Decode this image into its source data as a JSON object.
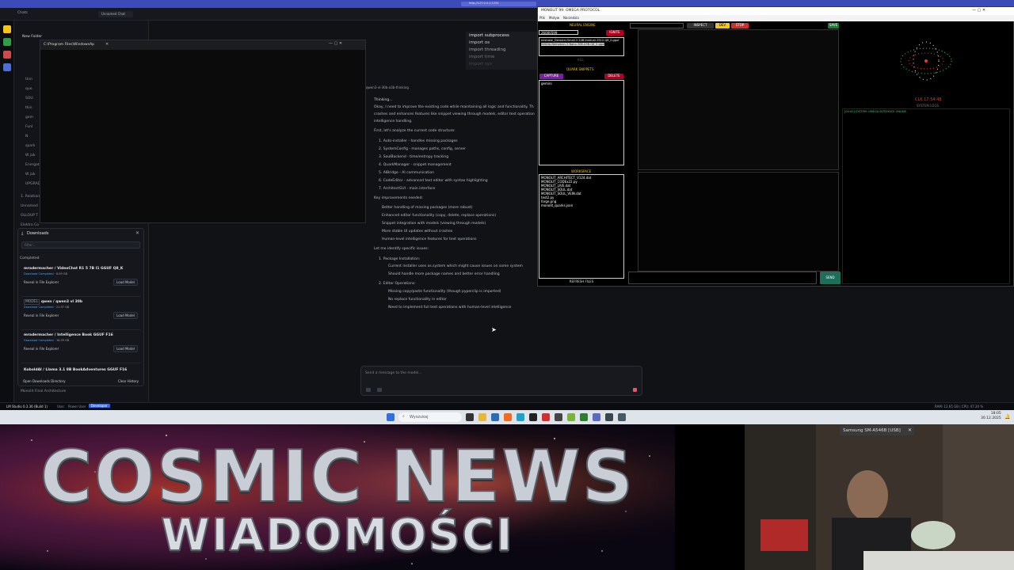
{
  "lm": {
    "title_tab": "LM Studio 0.3.36",
    "chat_tab": "Unnamed Chat",
    "sidebar": {
      "header": "Chats",
      "folder": "New Folder",
      "items": [
        "Unn",
        "quo",
        "SOU",
        "tkin",
        "gem",
        "Funl",
        "N",
        "spark",
        "W jak",
        "Energetic",
        "W jak",
        "UPGRAD",
        "1. Relation",
        "Unnamed",
        "OLLOUP T",
        "Elektro Co",
        "Energetic C"
      ],
      "footer": "Monolit Final Architecture"
    },
    "explorer_title": "C:\\Program Files\\WindowsAp",
    "status_bar": {
      "app": "LM Studio 0.3.36 (Build 1)",
      "modes": [
        "User",
        "Power User",
        "Developer"
      ],
      "right": "RAM: 12.65 GB | CPU: 47.20 %"
    }
  },
  "downloads": {
    "title": "Downloads",
    "filter_placeholder": "Filter...",
    "section": "Completed",
    "items": [
      {
        "name": "mradermacher / VideoChat R1 5 7B I1 GGUF Q8_K",
        "status": "Download Completed",
        "size": "8.09 GB",
        "reveal": "Reveal in File Explorer",
        "load": "Load Model"
      },
      {
        "name": "qwen / qwen3 vl 30b",
        "badge": "MODEL",
        "status": "Download Completed",
        "size": "21.97 GB",
        "reveal": "Reveal in File Explorer",
        "load": "Load Model"
      },
      {
        "name": "mradermacher / Intelligence Book GGUF F16",
        "status": "Download Completed",
        "size": "16.09 GB",
        "reveal": "Reveal in File Explorer",
        "load": "Load Model"
      },
      {
        "name": "KoboldAI / Llama 3.1 8B BookAdventures GGUF F16",
        "status": "",
        "size": "",
        "reveal": "",
        "load": ""
      }
    ],
    "open_dir": "Open Downloads Directory",
    "clear": "Clear History"
  },
  "imports": [
    "import subprocess",
    "import os",
    "import threading",
    "import time",
    "import sys"
  ],
  "chat": {
    "model_label": "qwen3-vl-30b-a3b-thinking",
    "thinking": "Thinking...",
    "intro": [
      "Okay, I need to improve the existing code while maintaining all logic and functionality. Th",
      "crashes and enhances features like snippet viewing through models, editor text operation",
      "intelligence handling."
    ],
    "analyze": "First, let's analyze the current code structure:",
    "structure": [
      "1. Auto-installer - handles missing packages",
      "2. SystemConfig - manages paths, config, server",
      "3. SoulBackend - time/entropy tracking",
      "4. QuarkManager - snippet management",
      "5. AIBridge - AI communication",
      "6. CodeEditor - advanced text editor with syntax highlighting",
      "7. ArchitectGUI - main interface"
    ],
    "improvements_title": "Key improvements needed:",
    "improvements": [
      "Better handling of missing packages (more robust)",
      "Enhanced editor functionality (copy, delete, replace operations)",
      "Snippet integration with models (viewing through models)",
      "More stable UI updates without crashes",
      "Human-level intelligence features for text operations"
    ],
    "issues_title": "Let me identify specific issues:",
    "issue1": "1. Package Installation:",
    "issue1_items": [
      "Current installer uses os.system which might cause issues on some system",
      "Should handle more package names and better error handling"
    ],
    "issue2": "2. Editor Operations:",
    "issue2_items": [
      "Missing copy/paste functionality (though pyperclip is imported)",
      "No replace functionality in editor",
      "Need to implement full text operations with human-level intelligence"
    ],
    "composer_placeholder": "Send a message to the model..."
  },
  "monolith": {
    "title": "MONOLIT 99: OMEGA PROTOCOL",
    "menu": [
      "Plik",
      "Motyw",
      "Narzedzia"
    ],
    "toolbar": {
      "inspect": "INSPECT",
      "dev": "DEV",
      "stop": "STOP",
      "save": "SAVE"
    },
    "neural_engine": "NEURAL ENGINE",
    "ignite": "IGNITE",
    "port": "26000599",
    "models": [
      "mistralai_Devstral-Small-2-24B-Instruct-2512-Q8_0.gguf",
      "NVIDIA-Nemotron-3-Nano-30B-A3B-Q8_0.gguf"
    ],
    "kill": "KILL",
    "quark_snippets": "QUARK SNIPPETS",
    "capture": "CAPTURE",
    "delete": "DELETE",
    "snippet": "gemini",
    "workspace": "WORKSPACE",
    "files": [
      "MONOLIT_ARCHITECT_V124.dat",
      "MONOLIT_CODEx22.py",
      "MONOLIT_LIVE.dat",
      "MONOLIT_SOUL.dat",
      "MONOLIT_SOUL_VEIN.dat",
      "test2.py",
      "forge.png",
      "monolit_quarks.json"
    ],
    "refresh": "REFRESH FILES",
    "clock": "CLK 17:54:48",
    "system_logs": "SYSTEM LOGS",
    "log_line": "[00:00] SYSTEM: OMEGA INTERFACE ONLINE.",
    "send": "SEND"
  },
  "taskbar": {
    "search": "Wyszukaj",
    "time": "18:05",
    "date": "30.12.2025"
  },
  "overlay": {
    "line1": "COSMIC NEWS",
    "line2": "WIADOMOŚCI"
  },
  "camera_label": "Samsung SM-A546B [USB]"
}
